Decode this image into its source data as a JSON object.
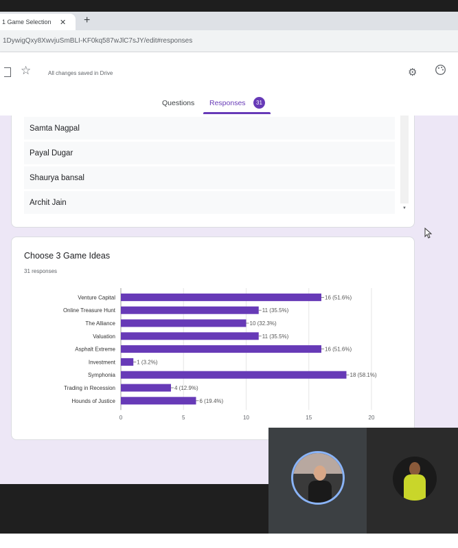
{
  "browser": {
    "tab_title": "1 Game Selection",
    "tab_close": "✕",
    "new_tab": "+",
    "url": "1DywigQxy8XwvjuSmBLI-KF0kq587wJlC7sJY/edit#responses"
  },
  "header": {
    "saved_status": "All changes saved in Drive",
    "tabs": {
      "questions": "Questions",
      "responses": "Responses",
      "responses_count": "31"
    },
    "icons": [
      "folder-icon",
      "star-icon",
      "addon-icon",
      "palette-icon"
    ]
  },
  "names_list": [
    "Samta Nagpal",
    "Payal Dugar",
    "Shaurya bansal",
    "Archit Jain"
  ],
  "question": {
    "title": "Choose 3 Game Ideas",
    "response_count": "31 responses"
  },
  "chart_data": {
    "type": "bar",
    "orientation": "horizontal",
    "categories": [
      "Venture Capital",
      "Online Treasure Hunt",
      "The Alliance",
      "Valuation",
      "Asphalt Extreme",
      "Investment",
      "Symphonia",
      "Trading in Recession",
      "Hounds of Justice"
    ],
    "values": [
      16,
      11,
      10,
      11,
      16,
      1,
      18,
      4,
      6
    ],
    "data_labels": [
      "16 (51.6%)",
      "11 (35.5%)",
      "10 (32.3%)",
      "11 (35.5%)",
      "16 (51.6%)",
      "1 (3.2%)",
      "18 (58.1%)",
      "4 (12.9%)",
      "6 (19.4%)"
    ],
    "xlim": [
      0,
      20
    ],
    "xticks": [
      0,
      5,
      10,
      15,
      20
    ],
    "bar_color": "#673ab7",
    "grid": true
  },
  "colors": {
    "accent": "#673ab7",
    "page_bg": "#ede7f6"
  }
}
